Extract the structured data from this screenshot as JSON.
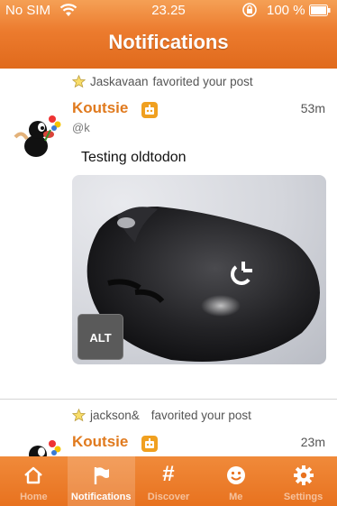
{
  "status_bar": {
    "carrier": "No SIM",
    "time": "23.25",
    "battery": "100 %"
  },
  "nav": {
    "title": "Notifications"
  },
  "notifications": [
    {
      "action_user": "Jaskavaan",
      "action_text": "favorited your post",
      "display_name": "Koutsie",
      "handle": "@k",
      "time": "53m",
      "content": "Testing oldtodon",
      "media_alt_button": "ALT"
    },
    {
      "action_user": "jackson&",
      "action_text": "favorited your post",
      "display_name": "Koutsie",
      "time": "23m"
    }
  ],
  "tabs": [
    {
      "label": "Home",
      "icon": "home-icon",
      "active": false
    },
    {
      "label": "Notifications",
      "icon": "flag-icon",
      "active": true
    },
    {
      "label": "Discover",
      "icon": "hashtag-icon",
      "active": false
    },
    {
      "label": "Me",
      "icon": "smiley-icon",
      "active": false
    },
    {
      "label": "Settings",
      "icon": "gear-icon",
      "active": false
    }
  ],
  "colors": {
    "accent": "#ec7b2e",
    "name": "#e07a1e"
  }
}
